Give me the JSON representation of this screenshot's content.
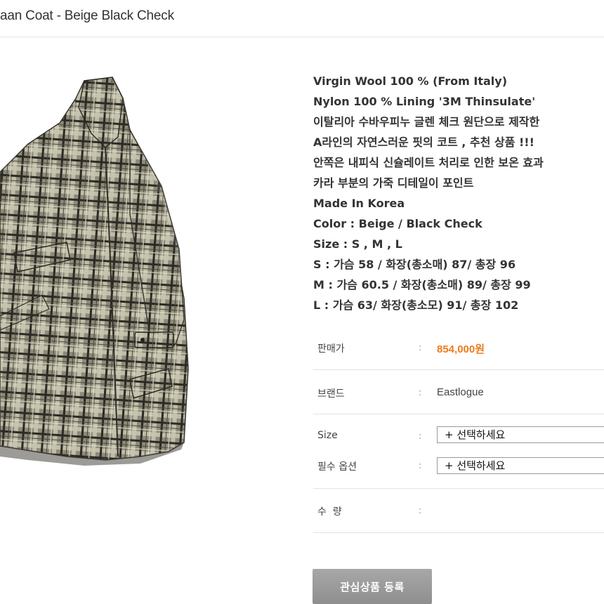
{
  "product": {
    "title": "aan Coat - Beige Black Check"
  },
  "description": [
    "Virgin Wool 100 % (From Italy)",
    "Nylon 100 % Lining '3M Thinsulate'",
    "이탈리아 수바우피누 글렌 체크 원단으로 제작한",
    "A라인의 자연스러운 핏의 코트 , 추천 상품 !!!",
    "안쪽은 내피식 신슐레이트 처리로 인한 보온 효과",
    "카라 부분의 가죽 디테일이 포인트",
    "Made In Korea",
    "Color : Beige / Black Check",
    "Size : S , M , L",
    "S :  가슴 58 / 화장(총소매) 87/ 총장 96",
    "M : 가슴 60.5 / 화장(총소매) 89/ 총장 99",
    "L : 가슴 63/ 화장(총소모) 91/ 총장 102"
  ],
  "options": {
    "price_label": "판매가",
    "price_value": "854,000원",
    "brand_label": "브랜드",
    "brand_value": "Eastlogue",
    "size_label": "Size",
    "size_select": "+ 선택하세요",
    "required_label": "필수 옵션",
    "required_select": "+ 선택하세요",
    "quantity_label": "수  량",
    "colon": ":"
  },
  "buttons": {
    "wishlist": "관심상품 등록"
  },
  "colors": {
    "price": "#ee7a1c",
    "button": "#9a9a9a"
  }
}
